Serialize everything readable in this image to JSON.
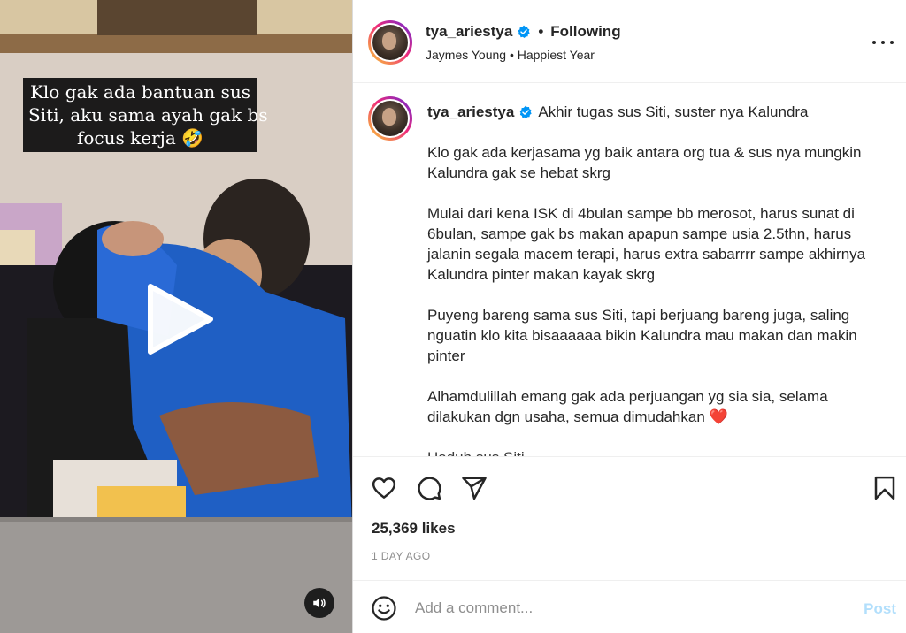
{
  "media": {
    "overlay_caption_lines": [
      "Klo gak ada bantuan sus",
      "Siti, aku sama ayah gak bs",
      "focus kerja 🤣"
    ],
    "play_icon": "play-icon",
    "mute_icon": "speaker-icon"
  },
  "header": {
    "username": "tya_ariestya",
    "separator": "•",
    "follow_status": "Following",
    "audio": "Jaymes Young • Happiest Year",
    "verified_icon": "verified-badge-icon",
    "more_icon": "more-options-icon"
  },
  "caption": {
    "username": "tya_ariestya",
    "first_line": "Akhir tugas sus Siti, suster nya Kalundra",
    "paragraphs": [
      "Klo gak ada kerjasama yg baik antara org tua & sus nya mungkin Kalundra gak se hebat skrg",
      "Mulai dari kena ISK di 4bulan sampe bb merosot, harus sunat di 6bulan, sampe gak bs makan apapun sampe usia 2.5thn, harus jalanin segala macem terapi, harus extra sabarrrr sampe akhirnya Kalundra pinter makan kayak skrg",
      "Puyeng bareng sama sus Siti, tapi berjuang bareng juga, saling nguatin klo kita bisaaaaaa bikin Kalundra mau makan dan makin pinter",
      "Alhamdulillah emang gak ada perjuangan yg sia sia, selama dilakukan dgn usaha, semua dimudahkan"
    ],
    "heart_emoji": "❤️",
    "partial_line": "Haduh sus Siti... "
  },
  "actions": {
    "like_icon": "heart-icon",
    "comment_icon": "comment-icon",
    "share_icon": "share-icon",
    "save_icon": "bookmark-icon",
    "likes": "25,369 likes",
    "time_ago": "1 DAY AGO"
  },
  "comment_box": {
    "emoji_icon": "emoji-icon",
    "placeholder": "Add a comment...",
    "post_label": "Post"
  },
  "colors": {
    "link_blue": "#0095f6",
    "post_disabled": "#b2dffc",
    "heart_red": "#e0245e",
    "verified_blue": "#0095f6"
  }
}
